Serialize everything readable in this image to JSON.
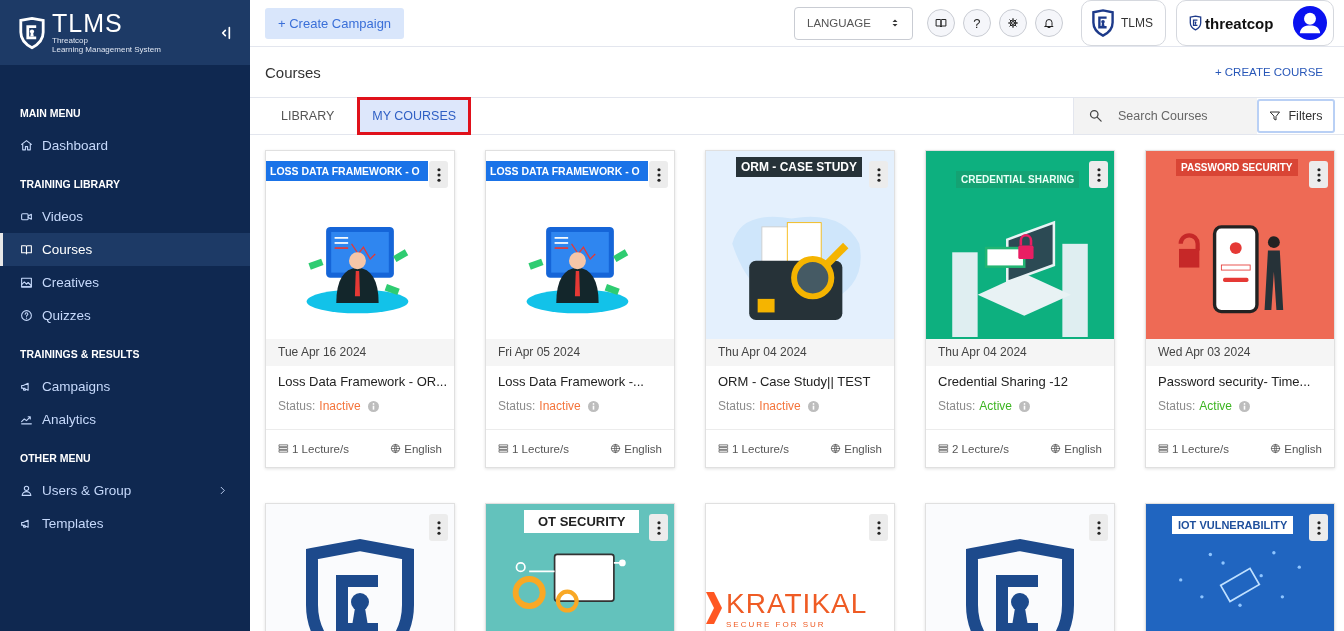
{
  "sidebar": {
    "logo": {
      "title": "TLMS",
      "subtitle_1": "Threatcop",
      "subtitle_2": "Learning Management System"
    },
    "sections": [
      {
        "heading": "MAIN MENU",
        "items": [
          {
            "label": "Dashboard",
            "selected": false
          }
        ]
      },
      {
        "heading": "TRAINING LIBRARY",
        "items": [
          {
            "label": "Videos",
            "selected": false
          },
          {
            "label": "Courses",
            "selected": true
          },
          {
            "label": "Creatives",
            "selected": false
          },
          {
            "label": "Quizzes",
            "selected": false
          }
        ]
      },
      {
        "heading": "TRAININGS & RESULTS",
        "items": [
          {
            "label": "Campaigns",
            "selected": false
          },
          {
            "label": "Analytics",
            "selected": false
          }
        ]
      },
      {
        "heading": "OTHER MENU",
        "items": [
          {
            "label": "Users & Group",
            "selected": false,
            "expandable": true
          },
          {
            "label": "Templates",
            "selected": false,
            "expandable": false
          }
        ]
      }
    ]
  },
  "header": {
    "create_button": "+ Create Campaign",
    "language_select": "LANGUAGE",
    "help_button": "?",
    "product_badge": "TLMS",
    "company_logo": "threatcop"
  },
  "page": {
    "title": "Courses",
    "create_link": "+ CREATE COURSE"
  },
  "tabs": [
    {
      "label": "LIBRARY",
      "selected": false,
      "highlighted": false
    },
    {
      "label": "MY COURSES",
      "selected": true,
      "highlighted": true
    }
  ],
  "search": {
    "placeholder": "Search Courses"
  },
  "filters_button": "Filters",
  "cards": [
    {
      "thumbnail": {
        "kind": "loss-data",
        "banner": "LOSS DATA FRAMEWORK - O"
      },
      "date": "Tue Apr 16 2024",
      "title": "Loss Data Framework - OR...",
      "status_label": "Status:",
      "status": "Inactive",
      "active": false,
      "lectures": "1 Lecture/s",
      "language": "English"
    },
    {
      "thumbnail": {
        "kind": "loss-data",
        "banner": "LOSS DATA FRAMEWORK - O"
      },
      "date": "Fri Apr 05 2024",
      "title": "Loss Data Framework -...",
      "status_label": "Status:",
      "status": "Inactive",
      "active": false,
      "lectures": "1 Lecture/s",
      "language": "English"
    },
    {
      "thumbnail": {
        "kind": "case-study",
        "banner": "ORM - CASE STUDY"
      },
      "date": "Thu Apr 04 2024",
      "title": "ORM - Case Study|| TEST",
      "status_label": "Status:",
      "status": "Inactive",
      "active": false,
      "lectures": "1 Lecture/s",
      "language": "English"
    },
    {
      "thumbnail": {
        "kind": "credential",
        "banner": "CREDENTIAL SHARING"
      },
      "date": "Thu Apr 04 2024",
      "title": "Credential Sharing -12",
      "status_label": "Status:",
      "status": "Active",
      "active": true,
      "lectures": "2 Lecture/s",
      "language": "English"
    },
    {
      "thumbnail": {
        "kind": "password",
        "banner": "PASSWORD SECURITY"
      },
      "date": "Wed Apr 03 2024",
      "title": "Password security- Time...",
      "status_label": "Status:",
      "status": "Active",
      "active": true,
      "lectures": "1 Lecture/s",
      "language": "English"
    },
    {
      "thumbnail": {
        "kind": "shield"
      }
    },
    {
      "thumbnail": {
        "kind": "ot",
        "banner": "OT SECURITY"
      }
    },
    {
      "thumbnail": {
        "kind": "kratikal",
        "banner": "KRATIKAL",
        "tagline": "SECURE FOR SUR"
      }
    },
    {
      "thumbnail": {
        "kind": "shield"
      }
    },
    {
      "thumbnail": {
        "kind": "iot",
        "banner": "IOT VULNERABILITY"
      }
    }
  ]
}
